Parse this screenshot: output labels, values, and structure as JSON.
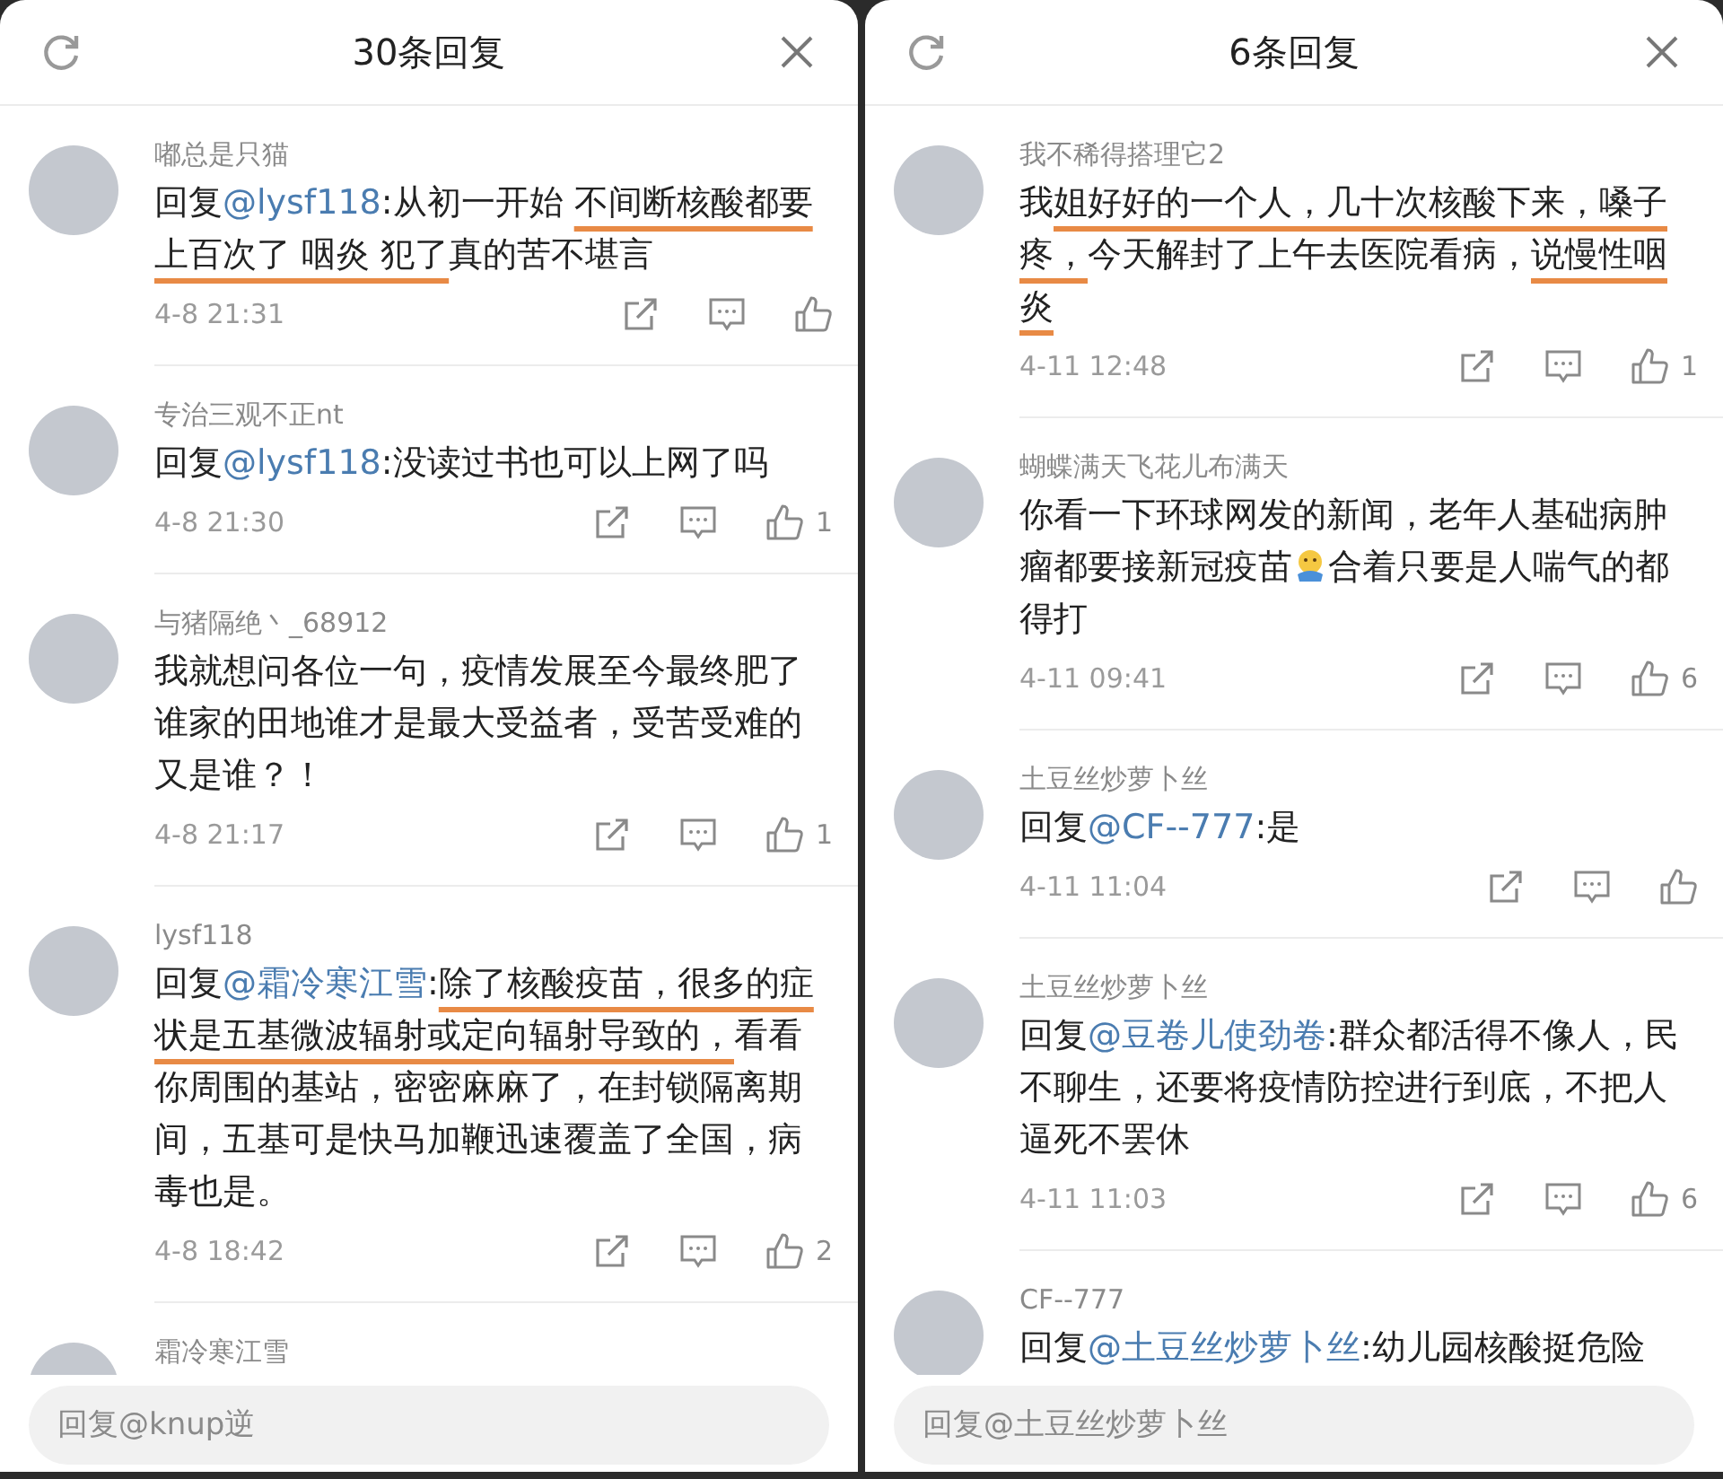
{
  "panels": [
    {
      "title": "30条回复",
      "comments": [
        {
          "name": "嘟总是只猫",
          "body": [
            {
              "kind": "plain",
              "text": "回复"
            },
            {
              "kind": "mention",
              "text": "@lysf118"
            },
            {
              "kind": "plain",
              "text": ":从初一开始 "
            },
            {
              "kind": "underlined",
              "text": "不间断核酸都要上百次了 咽炎 犯了"
            },
            {
              "kind": "plain",
              "text": "真的苦不堪言"
            }
          ],
          "time": "4-8 21:31"
        },
        {
          "name": "专治三观不正nt",
          "body": [
            {
              "kind": "plain",
              "text": "回复"
            },
            {
              "kind": "mention",
              "text": "@lysf118"
            },
            {
              "kind": "plain",
              "text": ":没读过书也可以上网了吗"
            }
          ],
          "time": "4-8 21:30",
          "likes": "1"
        },
        {
          "name": "与猪隔绝丶_68912",
          "body": [
            {
              "kind": "plain",
              "text": "我就想问各位一句，疫情发展至今最终肥了谁家的田地谁才是最大受益者，受苦受难的又是谁？！"
            }
          ],
          "time": "4-8 21:17",
          "likes": "1"
        },
        {
          "name": "lysf118",
          "body": [
            {
              "kind": "plain",
              "text": "回复"
            },
            {
              "kind": "mention",
              "text": "@霜冷寒江雪"
            },
            {
              "kind": "plain",
              "text": ":"
            },
            {
              "kind": "underlined",
              "text": "除了核酸疫苗，很多的症状是五基微波辐射或定向辐射导致的，"
            },
            {
              "kind": "plain",
              "text": "看看你周围的基站，密密麻麻了，在封锁隔离期间，五基可是快马加鞭迅速覆盖了全国，病毒也是。"
            }
          ],
          "time": "4-8 18:42",
          "likes": "2"
        },
        {
          "name": "霜冷寒江雪"
        }
      ],
      "reply_field": {
        "placeholder": "回复@knup逆"
      }
    },
    {
      "title": "6条回复",
      "comments": [
        {
          "name": "我不稀得搭理它2",
          "body": [
            {
              "kind": "plain",
              "text": "我"
            },
            {
              "kind": "underlined",
              "text": "姐好好的一个人，几十次核酸下来，嗓子疼，"
            },
            {
              "kind": "plain",
              "text": "今天解封了上午去医院看病，"
            },
            {
              "kind": "underlined",
              "text": "说慢性咽炎"
            }
          ],
          "time": "4-11 12:48",
          "likes": "1"
        },
        {
          "name": "蝴蝶满天飞花儿布满天",
          "body": [
            {
              "kind": "plain",
              "text": "你看一下环球网发的新闻，老年人基础病肿瘤都要接新冠疫苗"
            },
            {
              "kind": "emoji"
            },
            {
              "kind": "plain",
              "text": "合着只要是人喘气的都得打"
            }
          ],
          "time": "4-11 09:41",
          "likes": "6"
        },
        {
          "name": "土豆丝炒萝卜丝",
          "body": [
            {
              "kind": "plain",
              "text": "回复"
            },
            {
              "kind": "mention",
              "text": "@CF--777"
            },
            {
              "kind": "plain",
              "text": ":是"
            }
          ],
          "time": "4-11 11:04"
        },
        {
          "name": "土豆丝炒萝卜丝",
          "body": [
            {
              "kind": "plain",
              "text": "回复"
            },
            {
              "kind": "mention",
              "text": "@豆卷儿使劲卷"
            },
            {
              "kind": "plain",
              "text": ":群众都活得不像人，民不聊生，还要将疫情防控进行到底，不把人逼死不罢休"
            }
          ],
          "time": "4-11 11:03",
          "likes": "6"
        },
        {
          "name": "CF--777",
          "body": [
            {
              "kind": "plain",
              "text": "回复"
            },
            {
              "kind": "mention",
              "text": "@土豆丝炒萝卜丝"
            },
            {
              "kind": "plain",
              "text": ":幼儿园核酸挺危险"
            }
          ]
        }
      ],
      "reply_field": {
        "placeholder": "回复@土豆丝炒萝卜丝"
      }
    }
  ]
}
